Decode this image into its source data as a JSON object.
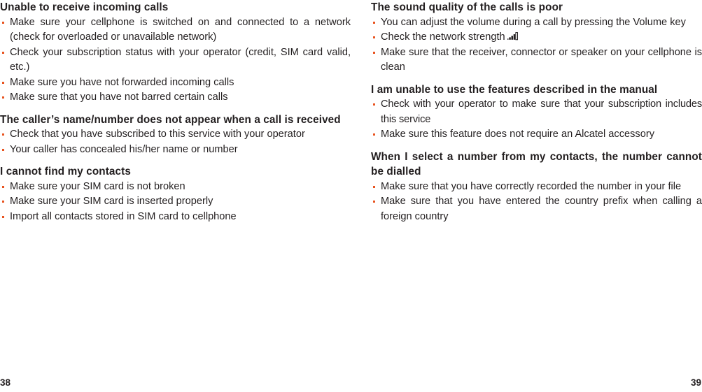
{
  "document": {
    "type": "user-manual-troubleshooting-spread",
    "accent_color": "#e8531f",
    "text_color": "#231f20",
    "background_color": "#ffffff"
  },
  "left_page": {
    "folio": "38",
    "sections": [
      {
        "heading": "Unable to receive incoming calls",
        "bullets": [
          "Make sure your cellphone is switched on and connected to a network (check for overloaded or unavailable network)",
          "Check your subscription status with your operator (credit, SIM card valid, etc.)",
          "Make sure you have not forwarded incoming calls",
          "Make sure that you have not barred certain calls"
        ]
      },
      {
        "heading": "The caller’s name/number does not appear when a call is received",
        "bullets": [
          "Check that you have subscribed to this service with your operator",
          "Your caller has concealed his/her name or number"
        ]
      },
      {
        "heading": "I cannot find my contacts",
        "bullets": [
          "Make sure your SIM card is not broken",
          "Make sure your SIM card is inserted properly",
          "Import all contacts stored in SIM card to cellphone"
        ]
      }
    ]
  },
  "right_page": {
    "folio": "39",
    "sections": [
      {
        "heading": "The sound quality of the calls is poor",
        "bullets": [
          "You can adjust the volume during a call by pressing the Volume key",
          "Check the network strength",
          "Make sure that the receiver, connector or speaker on your cellphone is clean"
        ],
        "bullet_icon": {
          "index": 1,
          "name": "signal-strength-icon",
          "bars": 5
        }
      },
      {
        "heading": "I am unable to use the features described in the manual",
        "bullets": [
          "Check with your operator to make sure that your subscription includes this service",
          "Make sure this feature does not require an Alcatel accessory"
        ]
      },
      {
        "heading": "When I select a number from my contacts, the number cannot be dialled",
        "bullets": [
          "Make sure that you have correctly recorded the number in your file",
          "Make sure that you have entered the country prefix when calling a foreign country"
        ]
      }
    ]
  }
}
